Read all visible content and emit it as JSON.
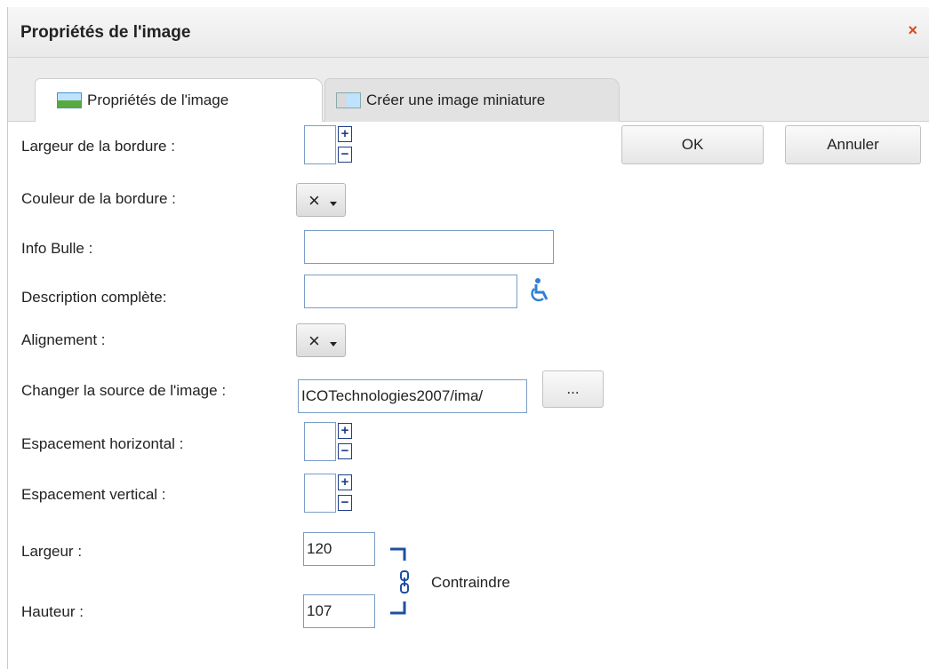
{
  "dialog": {
    "title": "Propriétés de l'image",
    "close_glyph": "×"
  },
  "tabs": [
    {
      "label": "Propriétés de l'image",
      "icon": "image-icon",
      "active": true
    },
    {
      "label": "Créer une image miniature",
      "icon": "thumbnail-icon",
      "active": false
    }
  ],
  "buttons": {
    "ok": "OK",
    "cancel": "Annuler",
    "browse": "..."
  },
  "fields": {
    "border_width": {
      "label": "Largeur de la bordure :",
      "value": ""
    },
    "border_color": {
      "label": "Couleur de la bordure :",
      "value": "×"
    },
    "tooltip": {
      "label": "Info Bulle :",
      "value": ""
    },
    "long_description": {
      "label": "Description complète:",
      "value": "",
      "icon": "accessibility-icon"
    },
    "alignment": {
      "label": "Alignement :",
      "value": "×"
    },
    "image_source": {
      "label": "Changer la source de l'image :",
      "value": "/ICOTechnologies2007/ima"
    },
    "hspace": {
      "label": "Espacement horizontal :",
      "value": ""
    },
    "vspace": {
      "label": "Espacement vertical :",
      "value": ""
    },
    "width": {
      "label": "Largeur :",
      "value": "120"
    },
    "height": {
      "label": "Hauteur :",
      "value": "107"
    },
    "constrain": {
      "label": "Contraindre",
      "icon": "link-icon"
    }
  },
  "spin": {
    "plus": "+",
    "minus": "−"
  },
  "colors": {
    "link_blue": "#1f4fa0",
    "close_orange": "#d84a1b",
    "accessibility_blue": "#2f7fd8"
  }
}
